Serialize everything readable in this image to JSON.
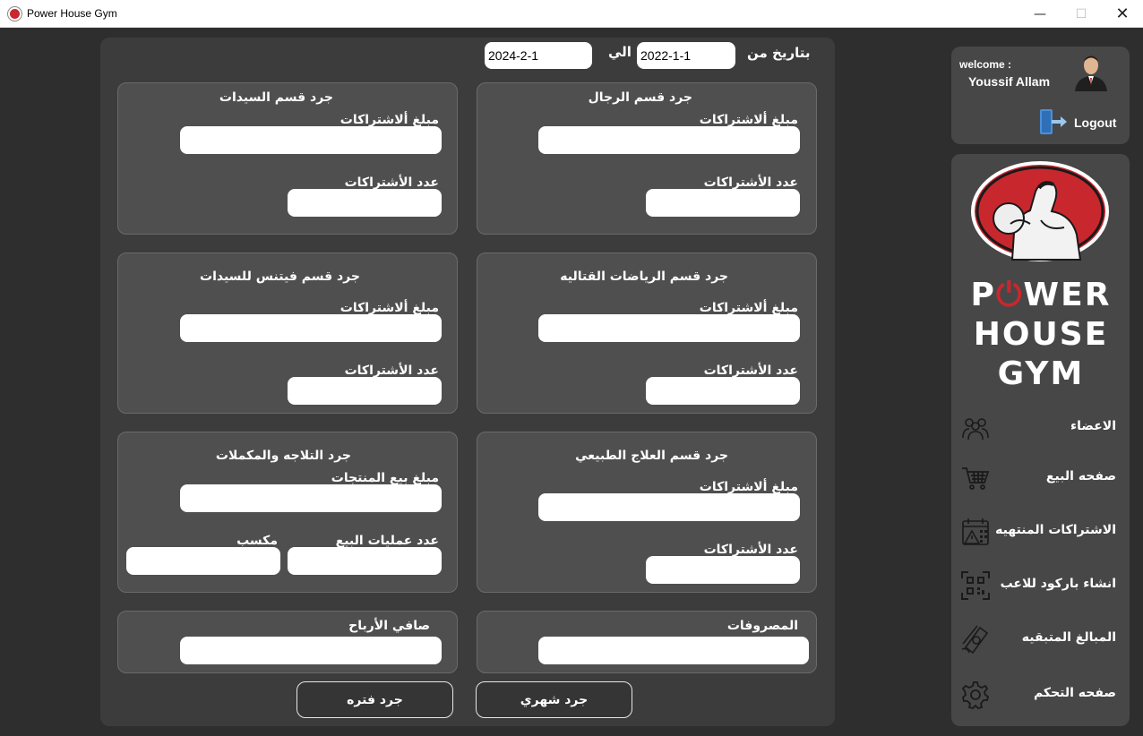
{
  "window": {
    "title": "Power House Gym",
    "minimize": "—",
    "maximize": "☐",
    "close": "✕"
  },
  "dates": {
    "from_label": "بتاريخ من",
    "from_value": "2022-1-1",
    "to_label": "الي",
    "to_value": "2024-2-1"
  },
  "cards": {
    "men": {
      "title": "جرد قسم الرجال",
      "amount_label": "مبلغ ألاشتراكات",
      "count_label": "عدد الأشتراكات",
      "amount_value": "",
      "count_value": ""
    },
    "women": {
      "title": "جرد قسم السيدات",
      "amount_label": "مبلغ ألاشتراكات",
      "count_label": "عدد الأشتراكات",
      "amount_value": "",
      "count_value": ""
    },
    "martial": {
      "title": "جرد قسم الرياضات القتاليه",
      "amount_label": "مبلغ ألاشتراكات",
      "count_label": "عدد الأشتراكات",
      "amount_value": "",
      "count_value": ""
    },
    "women_fitness": {
      "title": "جرد قسم فيتنس للسيدات",
      "amount_label": "مبلغ ألاشتراكات",
      "count_label": "عدد الأشتراكات",
      "amount_value": "",
      "count_value": ""
    },
    "physio": {
      "title": "جرد قسم العلاج الطبيعي",
      "amount_label": "مبلغ ألاشتراكات",
      "count_label": "عدد الأشتراكات",
      "amount_value": "",
      "count_value": ""
    },
    "fridge": {
      "title": "جرد التلاجه والمكملات",
      "sales_amount_label": "مبلغ بيع المنتجات",
      "sales_count_label": "عدد عمليات البيع",
      "profit_label": "مكسب",
      "sales_amount_value": "",
      "sales_count_value": "",
      "profit_value": ""
    },
    "expenses": {
      "title": "المصروفات",
      "value": ""
    },
    "net_profit": {
      "title": "صافي الأرباح",
      "value": ""
    }
  },
  "buttons": {
    "monthly": "جرد شهري",
    "period": "جرد فتره"
  },
  "user": {
    "welcome": "welcome :",
    "name": "Youssif Allam",
    "logout": "Logout"
  },
  "logo": {
    "line1_a": "P",
    "line1_b": "WER",
    "line2": "HOUSE",
    "line3": "GYM"
  },
  "nav": [
    {
      "label": "الاعضاء",
      "icon": "members-icon"
    },
    {
      "label": "صفحه البيع",
      "icon": "cart-icon"
    },
    {
      "label": "الاشتراكات المنتهيه",
      "icon": "calendar-alert-icon"
    },
    {
      "label": "انشاء باركود للاعب",
      "icon": "qr-code-icon"
    },
    {
      "label": "المبالغ المتبقيه",
      "icon": "money-icon"
    },
    {
      "label": "صفحه التحكم",
      "icon": "gear-icon"
    }
  ],
  "colors": {
    "background": "#2e2e2e",
    "panel": "#3c3c3c",
    "card": "#4f4f4f",
    "sidebar": "#474747",
    "logo_red": "#c9272e"
  }
}
